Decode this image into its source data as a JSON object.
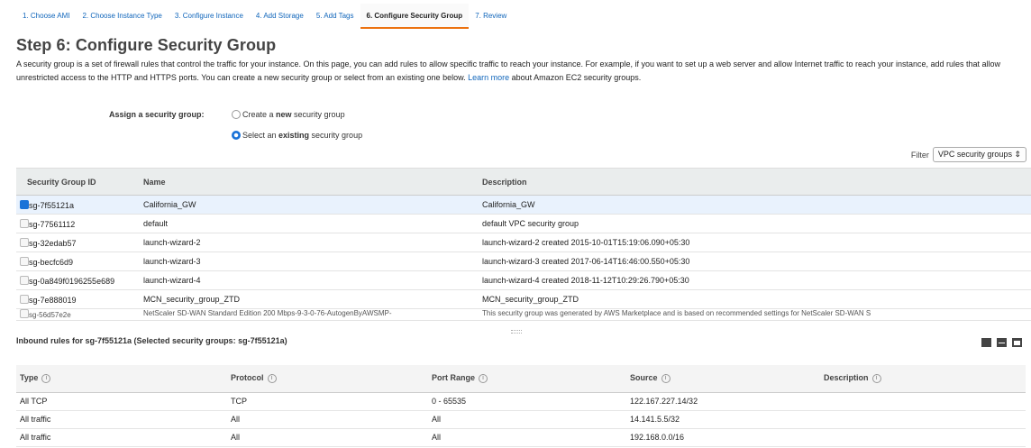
{
  "wizard": {
    "steps": [
      {
        "label": "1. Choose AMI"
      },
      {
        "label": "2. Choose Instance Type"
      },
      {
        "label": "3. Configure Instance"
      },
      {
        "label": "4. Add Storage"
      },
      {
        "label": "5. Add Tags"
      },
      {
        "label": "6. Configure Security Group",
        "active": true
      },
      {
        "label": "7. Review"
      }
    ]
  },
  "page": {
    "title": "Step 6: Configure Security Group",
    "intro_text": "A security group is a set of firewall rules that control the traffic for your instance. On this page, you can add rules to allow specific traffic to reach your instance. For example, if you want to set up a web server and allow Internet traffic to reach your instance, add rules that allow unrestricted access to the HTTP and HTTPS ports. You can create a new security group or select from an existing one below.",
    "learn_more": "Learn more",
    "intro_suffix": "about Amazon EC2 security groups."
  },
  "assign": {
    "label": "Assign a security group:",
    "create_pre": "Create a ",
    "create_bold": "new",
    "create_post": " security group",
    "select_pre": "Select an ",
    "select_bold": "existing",
    "select_post": " security group",
    "selected_option": "existing"
  },
  "filter": {
    "label": "Filter",
    "value": "VPC security groups"
  },
  "security_groups": {
    "headers": {
      "id": "Security Group ID",
      "name": "Name",
      "description": "Description"
    },
    "rows": [
      {
        "id": "sg-7f55121a",
        "name": "California_GW",
        "description": "California_GW",
        "selected": true
      },
      {
        "id": "sg-77561112",
        "name": "default",
        "description": "default VPC security group",
        "selected": false
      },
      {
        "id": "sg-32edab57",
        "name": "launch-wizard-2",
        "description": "launch-wizard-2 created 2015-10-01T15:19:06.090+05:30",
        "selected": false
      },
      {
        "id": "sg-becfc6d9",
        "name": "launch-wizard-3",
        "description": "launch-wizard-3 created 2017-06-14T16:46:00.550+05:30",
        "selected": false
      },
      {
        "id": "sg-0a849f0196255e689",
        "name": "launch-wizard-4",
        "description": "launch-wizard-4 created 2018-11-12T10:29:26.790+05:30",
        "selected": false
      },
      {
        "id": "sg-7e888019",
        "name": "MCN_security_group_ZTD",
        "description": "MCN_security_group_ZTD",
        "selected": false
      },
      {
        "id": "sg-56d57e2e",
        "name": "NetScaler SD-WAN Standard Edition 200 Mbps-9-3-0-76-AutogenByAWSMP-",
        "description": "This security group was generated by AWS Marketplace and is based on recommended settings for NetScaler SD-WAN S",
        "selected": false,
        "partial": true
      }
    ]
  },
  "inbound": {
    "title": "Inbound rules for sg-7f55121a (Selected security groups: sg-7f55121a)",
    "headers": {
      "type": "Type",
      "protocol": "Protocol",
      "port_range": "Port Range",
      "source": "Source",
      "description": "Description"
    },
    "rows": [
      {
        "type": "All TCP",
        "protocol": "TCP",
        "port_range": "0 - 65535",
        "source": "122.167.227.14/32",
        "description": ""
      },
      {
        "type": "All traffic",
        "protocol": "All",
        "port_range": "All",
        "source": "14.141.5.5/32",
        "description": ""
      },
      {
        "type": "All traffic",
        "protocol": "All",
        "port_range": "All",
        "source": "192.168.0.0/16",
        "description": ""
      }
    ]
  },
  "icons": {
    "info": "info-icon",
    "view_modes": [
      "panel-view-full-icon",
      "panel-view-split-icon",
      "panel-view-top-icon"
    ],
    "accent_color": "#1a73d8",
    "active_tab_color": "#ec7211"
  }
}
